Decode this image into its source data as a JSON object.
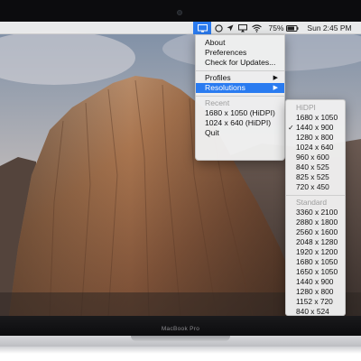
{
  "menubar": {
    "battery_percent": "75%",
    "clock": "Sun 2:45 PM",
    "icons": [
      "display-icon",
      "circle-status-icon",
      "location-arrow-icon",
      "airplay-icon",
      "wifi-icon",
      "battery-icon"
    ],
    "accent_color": "#2a7bf0"
  },
  "main_menu": {
    "about": "About",
    "preferences": "Preferences",
    "check_updates": "Check for Updates...",
    "profiles": "Profiles",
    "resolutions": "Resolutions",
    "recent_header": "Recent",
    "recent_items": [
      "1680 x 1050 (HiDPI)",
      "1024 x 640 (HiDPI)"
    ],
    "quit": "Quit"
  },
  "submenu": {
    "hidpi_header": "HiDPI",
    "hidpi_items": [
      "1680 x 1050",
      "1440 x 900",
      "1280 x 800",
      "1024 x 640",
      "960 x 600",
      "840 x 525",
      "825 x 525",
      "720 x 450"
    ],
    "selected_item": "1440 x 900",
    "checkmark": "✓",
    "standard_header": "Standard",
    "standard_items": [
      "3360 x 2100",
      "2880 x 1800",
      "2560 x 1600",
      "2048 x 1280",
      "1920 x 1200",
      "1680 x 1050",
      "1650 x 1050",
      "1440 x 900",
      "1280 x 800",
      "1152 x 720",
      "840 x 524"
    ]
  },
  "device": {
    "brand_label": "MacBook Pro"
  }
}
